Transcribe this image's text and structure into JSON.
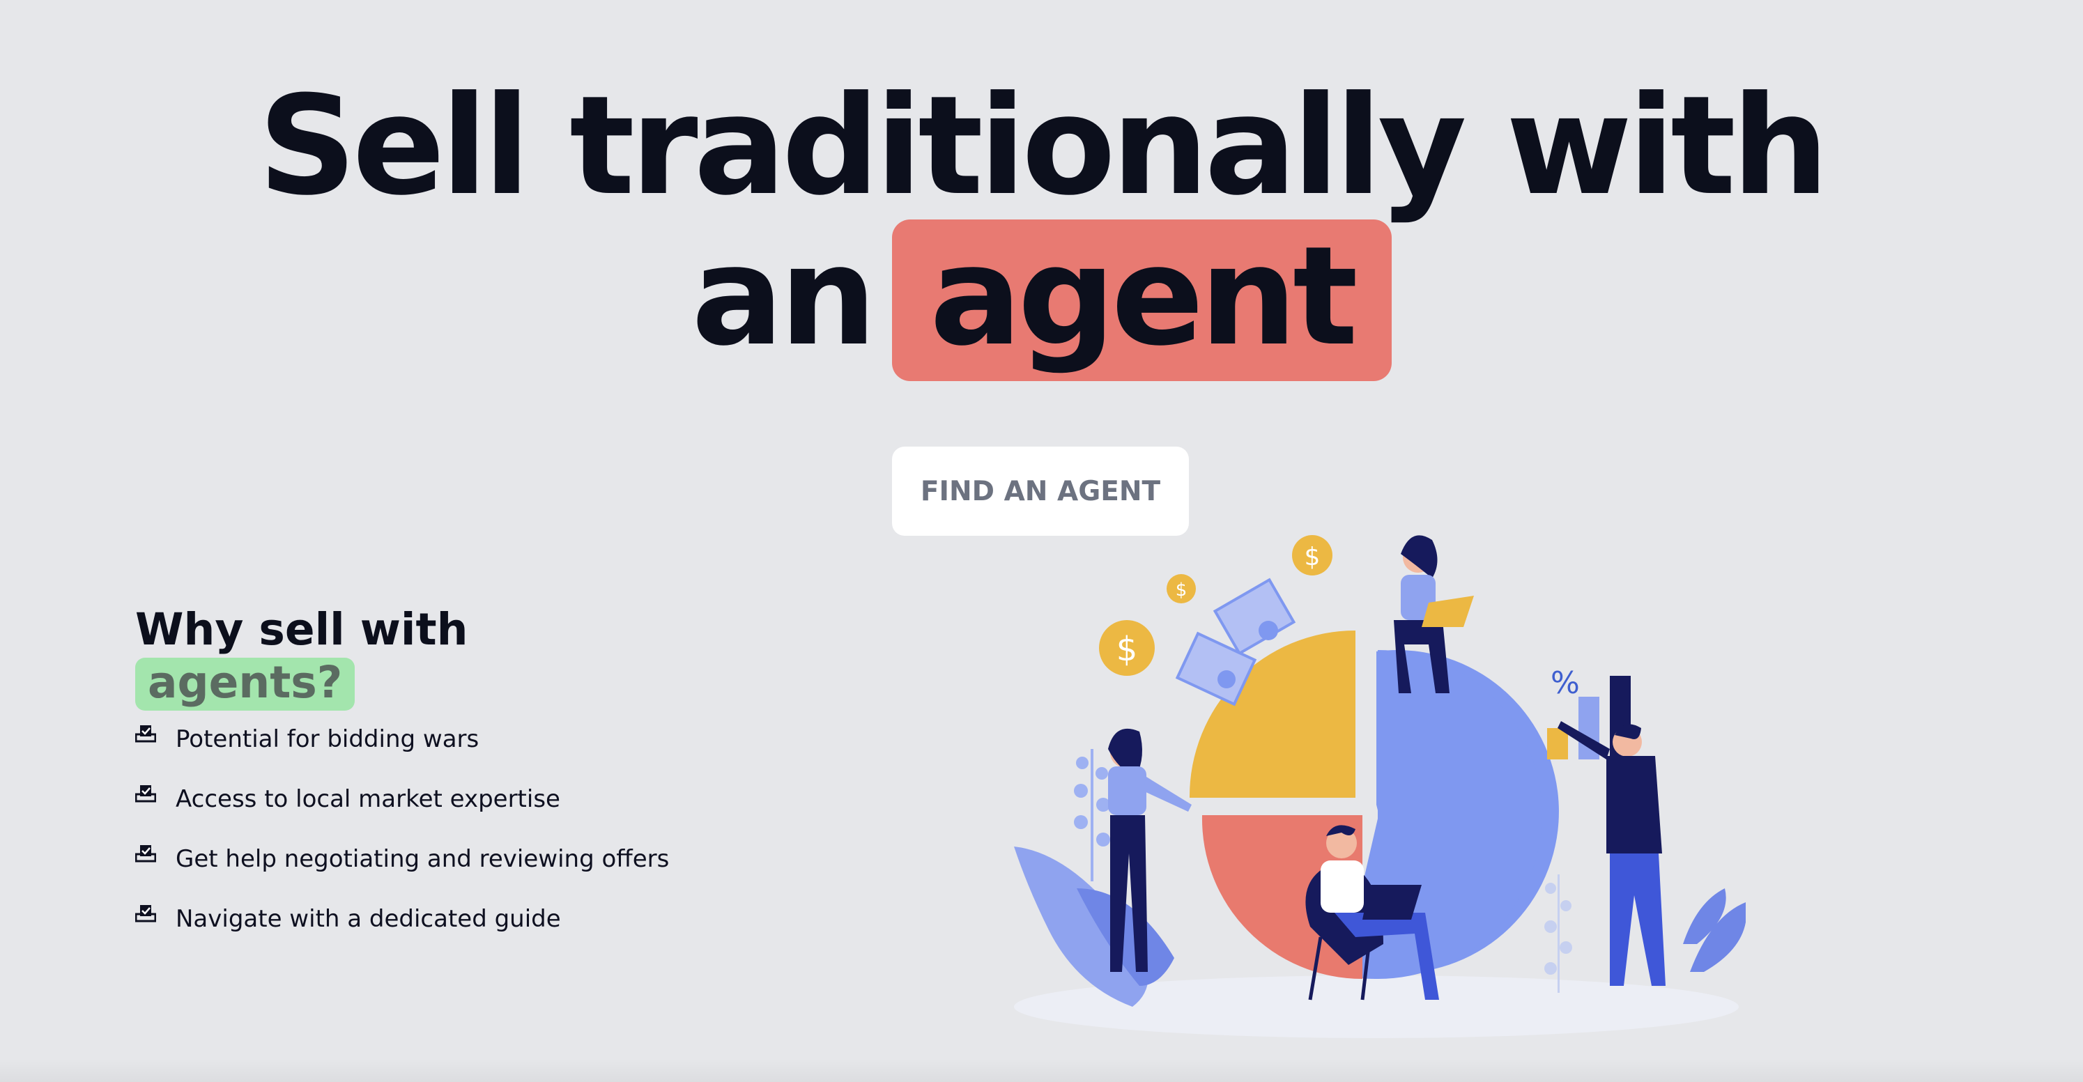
{
  "hero": {
    "line1": "Sell traditionally with",
    "line2_prefix": "an",
    "line2_highlight": "agent"
  },
  "cta": {
    "label": "FIND AN AGENT"
  },
  "why": {
    "title": "Why sell with",
    "title_highlight": "agents?",
    "items": [
      {
        "label": "Potential for bidding wars"
      },
      {
        "label": "Access to local market expertise"
      },
      {
        "label": "Get help negotiating and reviewing offers"
      },
      {
        "label": "Navigate with a dedicated guide"
      }
    ]
  },
  "illustration": {
    "percent_symbol": "%",
    "dollar_symbol": "$"
  },
  "colors": {
    "background": "#e6e7ea",
    "highlight_red": "#e87a72",
    "highlight_green": "#a3e5ad",
    "pie_yellow": "#ecb843",
    "pie_blue": "#7f98f0",
    "pie_red": "#e87a6e",
    "navy": "#161a5c"
  },
  "icons": {
    "list_item": "checkbox-tray-icon",
    "coins": "dollar-coin-icon",
    "bills": "banknote-icon"
  }
}
